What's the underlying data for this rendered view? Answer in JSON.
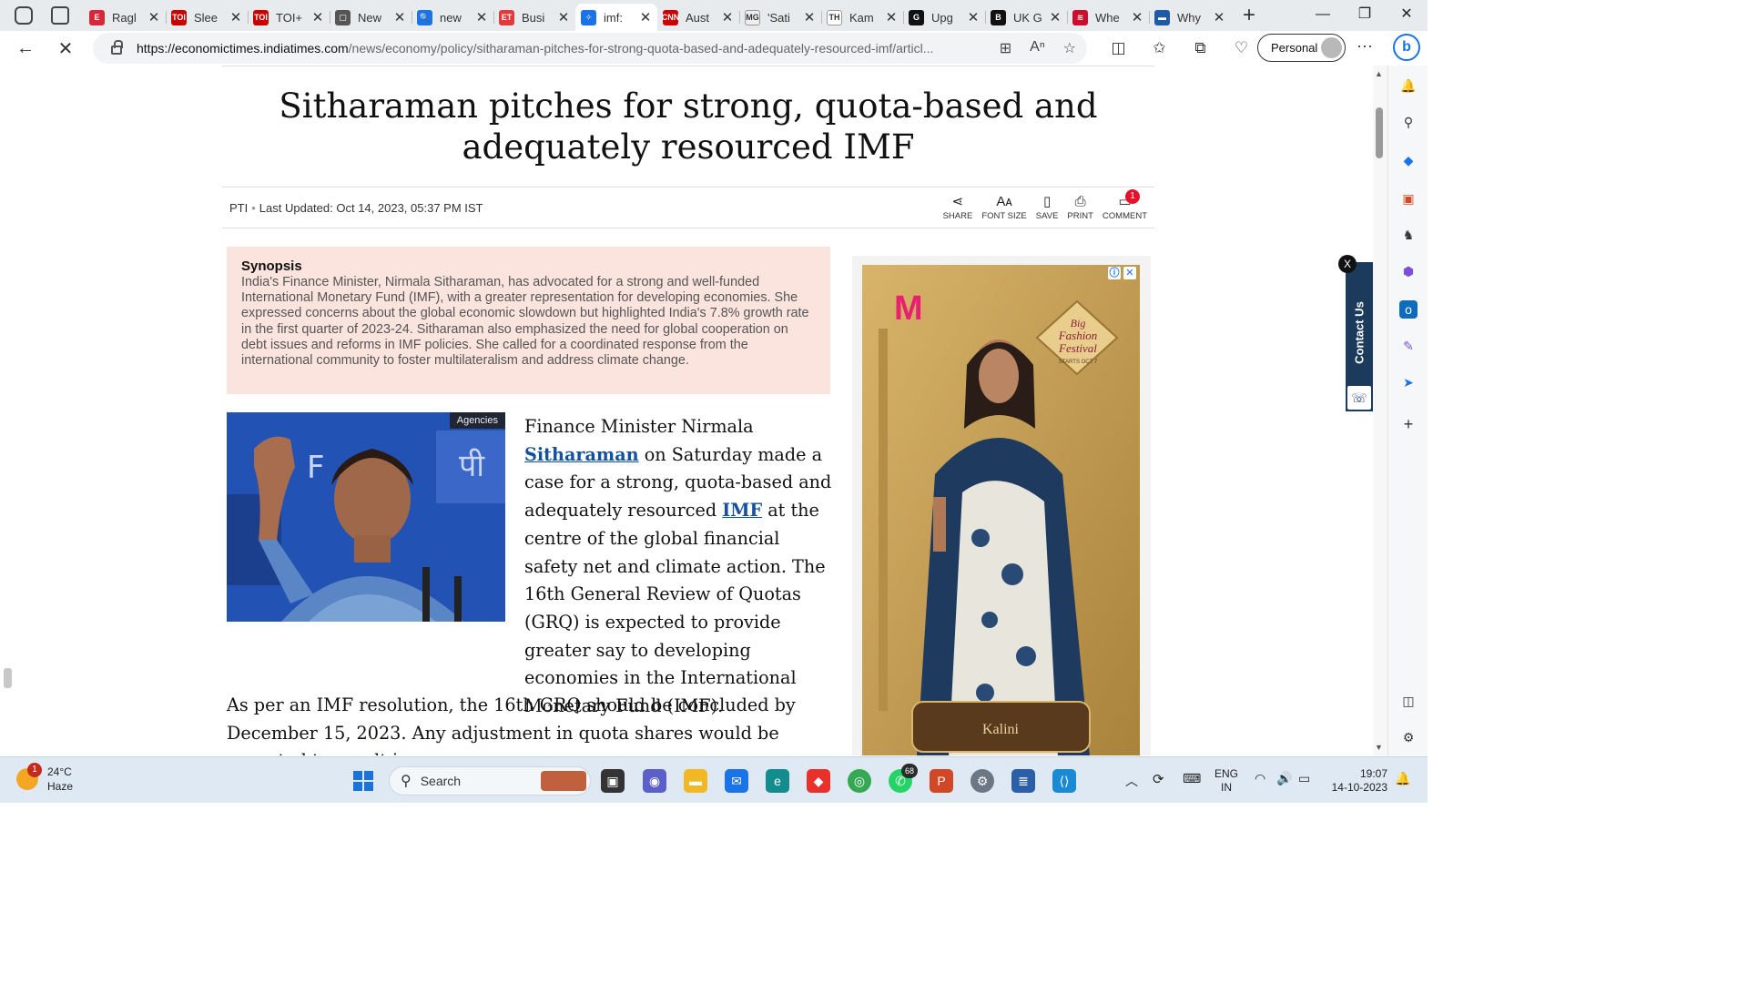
{
  "browser": {
    "tabs": [
      {
        "title": "Ragl",
        "favicon": "E",
        "color": "#d7283a"
      },
      {
        "title": "Slee",
        "favicon": "TOI",
        "color": "#c80000"
      },
      {
        "title": "TOI+",
        "favicon": "TOI",
        "color": "#c80000"
      },
      {
        "title": "New",
        "favicon": "▢",
        "color": "#555555"
      },
      {
        "title": "new",
        "favicon": "🔍",
        "color": "#1a73e8"
      },
      {
        "title": "Busi",
        "favicon": "ET",
        "color": "#e2393d"
      },
      {
        "title": "imf:",
        "favicon": "✧",
        "color": "#1a73e8",
        "active": true
      },
      {
        "title": "Aust",
        "favicon": "CNN",
        "color": "#cc0000"
      },
      {
        "title": "'Sati",
        "favicon": "MG",
        "color": "#eeeeee"
      },
      {
        "title": "Kam",
        "favicon": "TH",
        "color": "#ffffff"
      },
      {
        "title": "Upg",
        "favicon": "G",
        "color": "#111111"
      },
      {
        "title": "UK G",
        "favicon": "B",
        "color": "#111111"
      },
      {
        "title": "Whe",
        "favicon": "≋",
        "color": "#c8102e"
      },
      {
        "title": "Why",
        "favicon": "▬",
        "color": "#1e5aa8"
      }
    ],
    "url_domain": "https://economictimes.indiatimes.com",
    "url_path": "/news/economy/policy/sitharaman-pitches-for-strong-quota-based-and-adequately-resourced-imf/articl...",
    "profile_label": "Personal"
  },
  "article": {
    "title": "Sitharaman pitches for strong, quota-based and adequately resourced IMF",
    "source": "PTI",
    "updated": "Last Updated: Oct 14, 2023, 05:37 PM IST",
    "tools": {
      "share": "SHARE",
      "font_size": "FONT SIZE",
      "save": "SAVE",
      "print": "PRINT",
      "comment": "COMMENT",
      "comment_count": "1"
    },
    "synopsis_heading": "Synopsis",
    "synopsis_text": "India's Finance Minister, Nirmala Sitharaman, has advocated for a strong and well-funded International Monetary Fund (IMF), with a greater representation for developing economies. She expressed concerns about the global economic slowdown but highlighted India's 7.8% growth rate in the first quarter of 2023-24. Sitharaman also emphasized the need for global cooperation on debt issues and reforms in IMF policies. She called for a coordinated response from the international community to foster multilateralism and address climate change.",
    "photo_credit": "Agencies",
    "p1_before": "Finance Minister Nirmala ",
    "p1_link1": "Sitharaman",
    "p1_mid": " on Saturday made a case for a strong, quota-based and adequately resourced ",
    "p1_link2": "IMF",
    "p1_after": " at the centre of the global financial safety net and climate action. The 16th General Review of Quotas (GRQ) is expected to provide greater say to developing economies in the International Monetary Fund (IMF).",
    "p2": "As per an IMF resolution, the 16th GRQ should be concluded by December 15, 2023. Any adjustment in quota shares would be expected to result in an"
  },
  "ad": {
    "brand_letter": "M",
    "festival_line1": "Big",
    "festival_line2": "Fashion",
    "festival_line3": "Festival",
    "festival_tag": "STARTS OCT 7",
    "product_label": "Kalini"
  },
  "contact": {
    "label": "Contact Us",
    "close": "X"
  },
  "taskbar": {
    "temperature": "24°C",
    "condition": "Haze",
    "weather_badge": "1",
    "search_label": "Search",
    "whatsapp_badge": "68",
    "language": "ENG",
    "region": "IN",
    "time": "19:07",
    "date": "14-10-2023"
  }
}
